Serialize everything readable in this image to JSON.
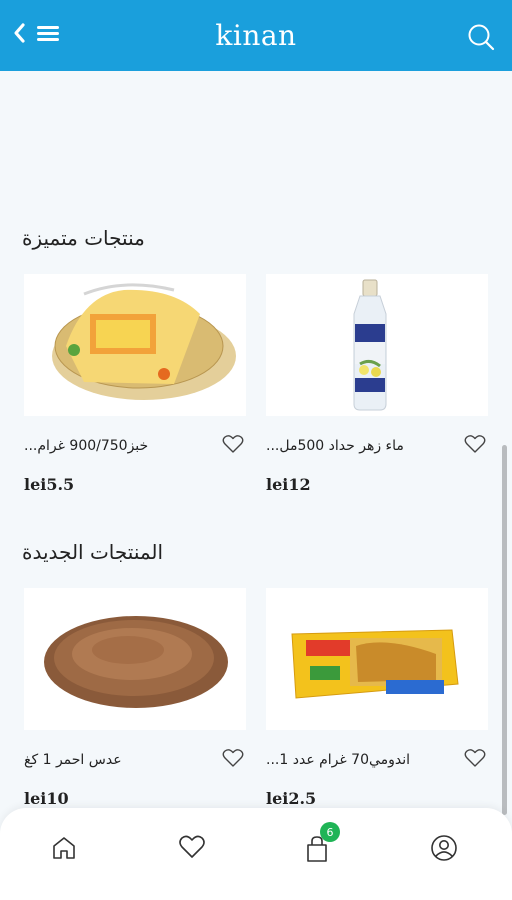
{
  "header": {
    "title": "kinan",
    "back_icon": "chevron-left-icon",
    "menu_icon": "menu-icon",
    "search_icon": "search-icon"
  },
  "sections": [
    {
      "title": "منتجات متميزة",
      "products": [
        {
          "name": "ماء زهر حداد 500مل...",
          "price": "lei12"
        },
        {
          "name": "خبز900/750 غرام...",
          "price": "lei5.5"
        }
      ]
    },
    {
      "title": "المنتجات الجديدة",
      "products": [
        {
          "name": "اندومي70 غرام عدد 1...",
          "price": "lei2.5"
        },
        {
          "name": "عدس احمر 1 كغ",
          "price": "lei10"
        }
      ]
    }
  ],
  "bottom_nav": {
    "items": [
      "home-icon",
      "heart-icon",
      "bag-icon",
      "user-icon"
    ],
    "cart_count": "6"
  },
  "colors": {
    "header": "#1a9fdc",
    "badge": "#1fb456",
    "background": "#f4f8fb"
  }
}
